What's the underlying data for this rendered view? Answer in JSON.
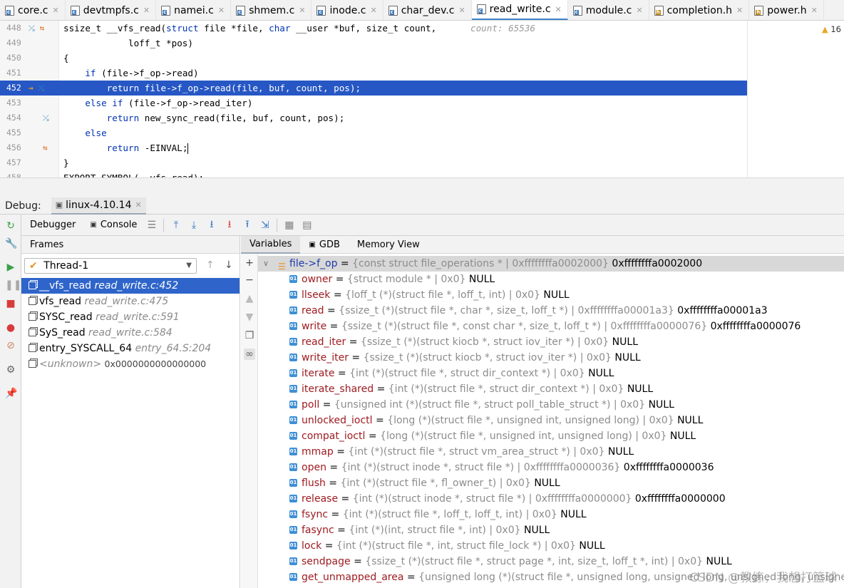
{
  "tabs": [
    {
      "label": "core.c",
      "type": "c",
      "active": false
    },
    {
      "label": "devtmpfs.c",
      "type": "c",
      "active": false
    },
    {
      "label": "namei.c",
      "type": "c",
      "active": false
    },
    {
      "label": "shmem.c",
      "type": "c",
      "active": false
    },
    {
      "label": "inode.c",
      "type": "c",
      "active": false
    },
    {
      "label": "char_dev.c",
      "type": "c",
      "active": false
    },
    {
      "label": "read_write.c",
      "type": "c",
      "active": true
    },
    {
      "label": "module.c",
      "type": "c",
      "active": false
    },
    {
      "label": "completion.h",
      "type": "h",
      "active": false
    },
    {
      "label": "power.h",
      "type": "h",
      "active": false
    }
  ],
  "editor": {
    "warning_count": "16",
    "lines": [
      {
        "num": "448",
        "text": "ssize_t __vfs_read(struct file *file, char __user *buf, size_t count,",
        "hint": "count: 65536"
      },
      {
        "num": "449",
        "text": "            loff_t *pos)"
      },
      {
        "num": "450",
        "text": "{"
      },
      {
        "num": "451",
        "text": "    if (file->f_op->read)"
      },
      {
        "num": "452",
        "text": "        return file->f_op->read(file, buf, count, pos);"
      },
      {
        "num": "453",
        "text": "    else if (file->f_op->read_iter)"
      },
      {
        "num": "454",
        "text": "        return new_sync_read(file, buf, count, pos);"
      },
      {
        "num": "455",
        "text": "    else"
      },
      {
        "num": "456",
        "text": "        return -EINVAL;"
      },
      {
        "num": "457",
        "text": "}"
      },
      {
        "num": "458",
        "text": "EXPORT_SYMBOL(__vfs_read);"
      }
    ]
  },
  "debug": {
    "label": "Debug:",
    "session": "linux-4.10.14",
    "toolbar_tabs": {
      "debugger": "Debugger",
      "console": "Console"
    },
    "frames_header": "Frames",
    "thread": "Thread-1",
    "frames": [
      {
        "func": "__vfs_read",
        "loc": "read_write.c:452"
      },
      {
        "func": "vfs_read",
        "loc": "read_write.c:475"
      },
      {
        "func": "SYSC_read",
        "loc": "read_write.c:591"
      },
      {
        "func": "SyS_read",
        "loc": "read_write.c:584"
      },
      {
        "func": "entry_SYSCALL_64",
        "loc": "entry_64.S:204"
      },
      {
        "func": "<unknown>",
        "loc": "0x0000000000000000"
      }
    ],
    "var_tabs": {
      "variables": "Variables",
      "gdb": "GDB",
      "memory": "Memory View"
    },
    "head_var": {
      "name": "file->f_op",
      "type": "{const struct file_operations * | 0xffffffffa0002000}",
      "value": "0xffffffffa0002000"
    },
    "vars": [
      {
        "name": "owner",
        "type": "{struct module * | 0x0}",
        "value": "NULL"
      },
      {
        "name": "llseek",
        "type": "{loff_t (*)(struct file *, loff_t, int) | 0x0}",
        "value": "NULL"
      },
      {
        "name": "read",
        "type": "{ssize_t (*)(struct file *, char *, size_t, loff_t *) | 0xffffffffa00001a3}",
        "value": "0xffffffffa00001a3"
      },
      {
        "name": "write",
        "type": "{ssize_t (*)(struct file *, const char *, size_t, loff_t *) | 0xffffffffa0000076}",
        "value": "0xffffffffa0000076"
      },
      {
        "name": "read_iter",
        "type": "{ssize_t (*)(struct kiocb *, struct iov_iter *) | 0x0}",
        "value": "NULL"
      },
      {
        "name": "write_iter",
        "type": "{ssize_t (*)(struct kiocb *, struct iov_iter *) | 0x0}",
        "value": "NULL"
      },
      {
        "name": "iterate",
        "type": "{int (*)(struct file *, struct dir_context *) | 0x0}",
        "value": "NULL"
      },
      {
        "name": "iterate_shared",
        "type": "{int (*)(struct file *, struct dir_context *) | 0x0}",
        "value": "NULL"
      },
      {
        "name": "poll",
        "type": "{unsigned int (*)(struct file *, struct poll_table_struct *) | 0x0}",
        "value": "NULL"
      },
      {
        "name": "unlocked_ioctl",
        "type": "{long (*)(struct file *, unsigned int, unsigned long) | 0x0}",
        "value": "NULL"
      },
      {
        "name": "compat_ioctl",
        "type": "{long (*)(struct file *, unsigned int, unsigned long) | 0x0}",
        "value": "NULL"
      },
      {
        "name": "mmap",
        "type": "{int (*)(struct file *, struct vm_area_struct *) | 0x0}",
        "value": "NULL"
      },
      {
        "name": "open",
        "type": "{int (*)(struct inode *, struct file *) | 0xffffffffa0000036}",
        "value": "0xffffffffa0000036"
      },
      {
        "name": "flush",
        "type": "{int (*)(struct file *, fl_owner_t) | 0x0}",
        "value": "NULL"
      },
      {
        "name": "release",
        "type": "{int (*)(struct inode *, struct file *) | 0xffffffffa0000000}",
        "value": "0xffffffffa0000000"
      },
      {
        "name": "fsync",
        "type": "{int (*)(struct file *, loff_t, loff_t, int) | 0x0}",
        "value": "NULL"
      },
      {
        "name": "fasync",
        "type": "{int (*)(int, struct file *, int) | 0x0}",
        "value": "NULL"
      },
      {
        "name": "lock",
        "type": "{int (*)(struct file *, int, struct file_lock *) | 0x0}",
        "value": "NULL"
      },
      {
        "name": "sendpage",
        "type": "{ssize_t (*)(struct file *, struct page *, int, size_t, loff_t *, int) | 0x0}",
        "value": "NULL"
      },
      {
        "name": "get_unmapped_area",
        "type": "{unsigned long (*)(struct file *, unsigned long, unsigned long, unsigned long, unsigned lo",
        "value": ""
      }
    ]
  },
  "watermark": "CSDN @教练，我想打篮球"
}
